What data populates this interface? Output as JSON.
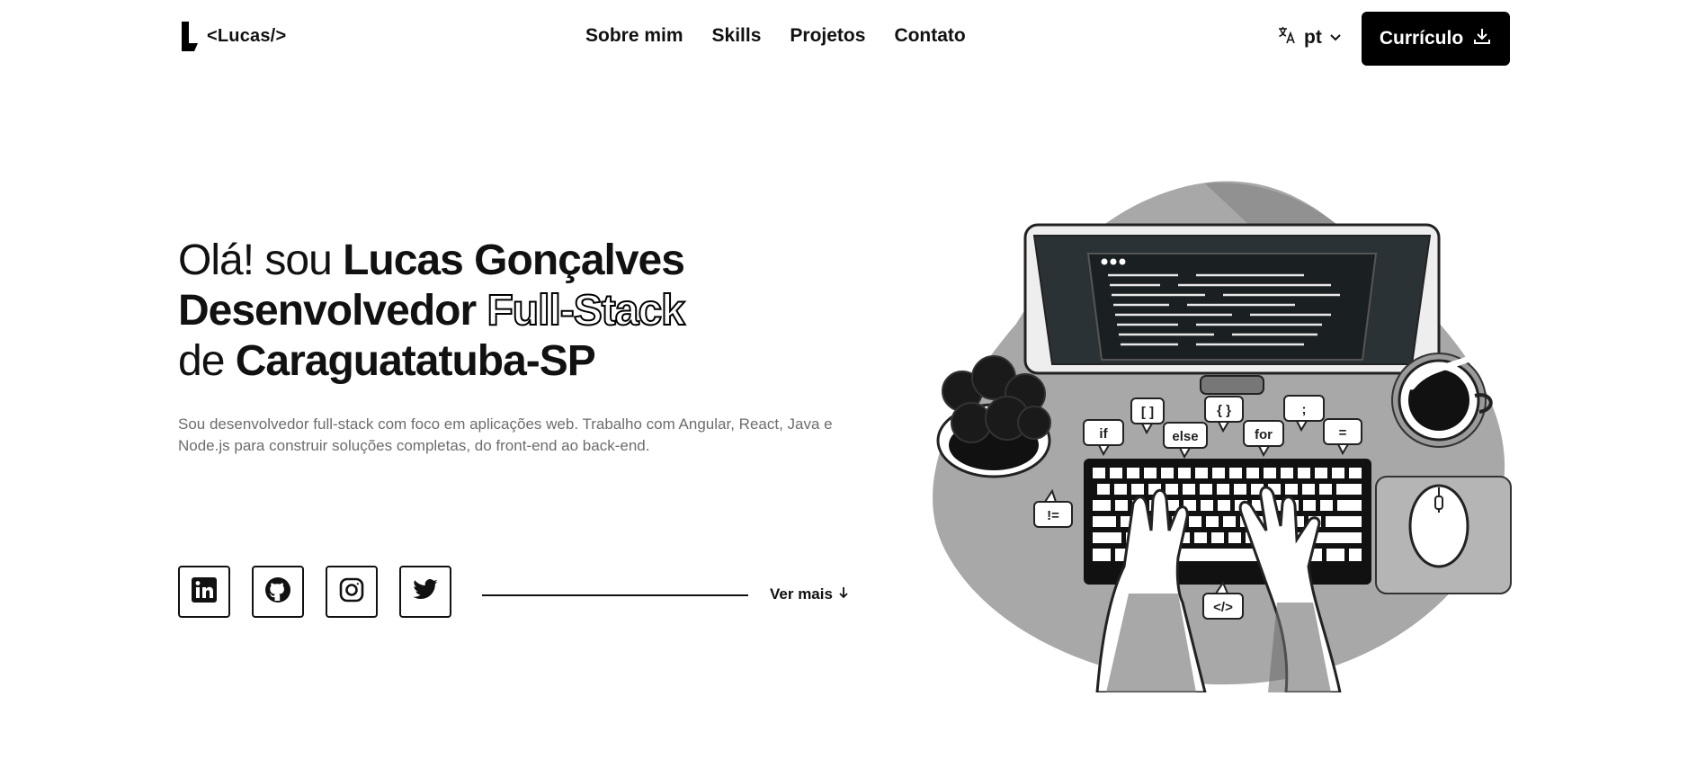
{
  "header": {
    "logo_text": "<Lucas/>",
    "nav": [
      "Sobre mim",
      "Skills",
      "Projetos",
      "Contato"
    ],
    "lang": "pt",
    "cv_label": "Currículo"
  },
  "hero": {
    "greeting": "Olá! sou ",
    "name": "Lucas Gonçalves",
    "role": "Desenvolvedor ",
    "role_highlight": "Full-Stack",
    "loc_prefix": "de ",
    "location": "Caraguatatuba-SP",
    "description": "Sou desenvolvedor full-stack com foco em aplicações web. Trabalho com Angular, React, Java e Node.js para construir soluções completas, do front-end ao back-end."
  },
  "socials": [
    "linkedin-icon",
    "github-icon",
    "instagram-icon",
    "twitter-icon"
  ],
  "see_more": "Ver mais",
  "illustration": {
    "bubbles": [
      "if",
      "[ ]",
      "else",
      "{ }",
      "for",
      ";",
      "=",
      "!=",
      "</>"
    ]
  },
  "colors": {
    "primary": "#000000",
    "background": "#ffffff",
    "muted_text": "#6d6d6d",
    "blob": "#a8a8a8"
  }
}
